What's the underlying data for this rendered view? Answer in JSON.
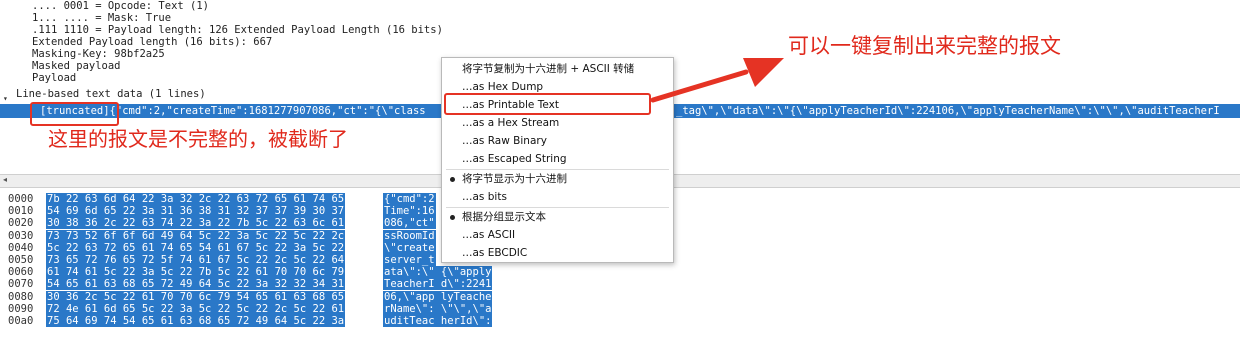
{
  "tree_lines": [
    ".... 0001 = Opcode: Text (1)",
    "1... .... = Mask: True",
    ".111 1110 = Payload length: 126 Extended Payload Length (16 bits)",
    "Extended Payload length (16 bits): 667",
    "Masking-Key: 98bf2a25",
    "Masked payload",
    "Payload"
  ],
  "line_based_header": "Line-based text data (1 lines)",
  "selected_row": {
    "truncated_tag": "[truncated]",
    "text": "{\"cmd\":2,\"createTime\":1681277907086,\"ct\":\"{\\\"class",
    "text_after_menu": "_tag\\\",\\\"data\\\":\\\"{\\\"applyTeacherId\\\":224106,\\\"applyTeacherName\\\":\\\"\\\",\\\"auditTeacherI"
  },
  "annotation_left": "这里的报文是不完整的，被截断了",
  "annotation_right": "可以一键复制出来完整的报文",
  "hex_rows": [
    {
      "offset": "0000",
      "hex": "7b 22 63 6d 64 22 3a 32  2c 22 63 72 65 61 74 65",
      "ascii": "{\"cmd\":2"
    },
    {
      "offset": "0010",
      "hex": "54 69 6d 65 22 3a 31 36  38 31 32 37 37 39 30 37",
      "ascii": "Time\":16"
    },
    {
      "offset": "0020",
      "hex": "30 38 36 2c 22 63 74 22  3a 22 7b 5c 22 63 6c 61",
      "ascii": "086,\"ct\""
    },
    {
      "offset": "0030",
      "hex": "73 73 52 6f 6f 6d 49 64  5c 22 3a 5c 22 5c 22 2c",
      "ascii": "ssRoomId"
    },
    {
      "offset": "0040",
      "hex": "5c 22 63 72 65 61 74 65  54 61 67 5c 22 3a 5c 22",
      "ascii": "\\\"create"
    },
    {
      "offset": "0050",
      "hex": "73 65 72 76 65 72 5f 74  61 67 5c 22 2c 5c 22 64",
      "ascii": "server_t"
    },
    {
      "offset": "0060",
      "hex": "61 74 61 5c 22 3a 5c 22  7b 5c 22 61 70 70 6c 79",
      "ascii": "ata\\\":\\\" {\\\"apply"
    },
    {
      "offset": "0070",
      "hex": "54 65 61 63 68 65 72 49  64 5c 22 3a 32 32 34 31",
      "ascii": "TeacherI d\\\":2241"
    },
    {
      "offset": "0080",
      "hex": "30 36 2c 5c 22 61 70 70  6c 79 54 65 61 63 68 65",
      "ascii": "06,\\\"app lyTeache"
    },
    {
      "offset": "0090",
      "hex": "72 4e 61 6d 65 5c 22 3a  5c 22 5c 22 2c 5c 22 61",
      "ascii": "rName\\\": \\\"\\\",\\\"a"
    },
    {
      "offset": "00a0",
      "hex": "75 64 69 74 54 65 61 63  68 65 72 49 64 5c 22 3a",
      "ascii": "uditTeac herId\\\":"
    }
  ],
  "context_menu": {
    "header_item": "将字节复制为十六进制 + ASCII 转储",
    "copy_items": [
      "…as Hex Dump",
      "…as Printable Text",
      "…as a Hex Stream",
      "…as Raw Binary",
      "…as Escaped String"
    ],
    "show_hex_item": "将字节显示为十六进制",
    "bits_item": "…as bits",
    "show_text_item": "根据分组显示文本",
    "text_items": [
      "…as ASCII",
      "…as EBCDIC"
    ]
  },
  "colors": {
    "selection": "#2a78c8",
    "annotation": "#e0291c"
  }
}
